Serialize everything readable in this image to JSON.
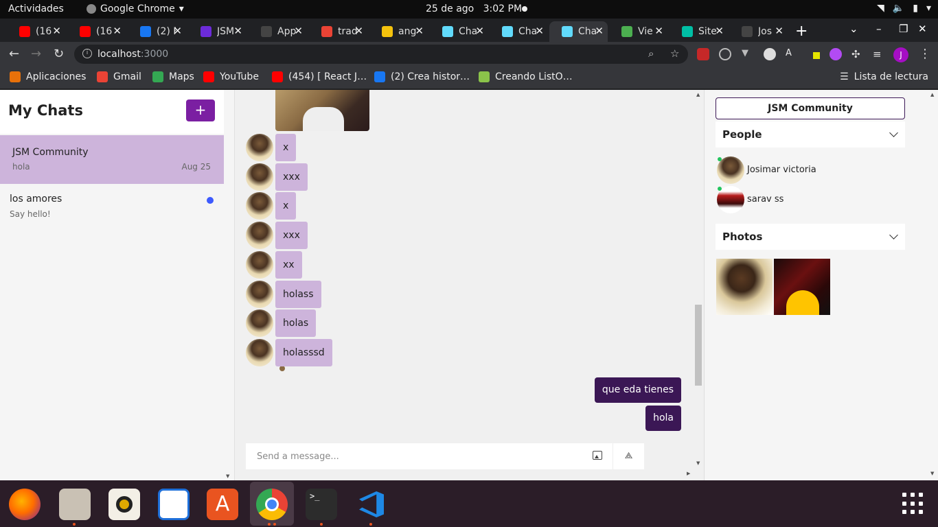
{
  "system_bar": {
    "activities": "Actividades",
    "app_name": "Google Chrome",
    "date": "25 de ago",
    "time": "3:02 PM"
  },
  "browser": {
    "tabs": [
      {
        "title": "(16",
        "icon": "youtube-icon",
        "color": "#ff0000"
      },
      {
        "title": "(16",
        "icon": "youtube-icon",
        "color": "#ff0000"
      },
      {
        "title": "(2) F",
        "icon": "facebook-icon",
        "color": "#1877f2"
      },
      {
        "title": "JSM",
        "icon": "jsm-icon",
        "color": "#6c2bd9"
      },
      {
        "title": "App",
        "icon": "github-icon",
        "color": "#444444"
      },
      {
        "title": "trad",
        "icon": "google-icon",
        "color": "#ea4335"
      },
      {
        "title": "ang",
        "icon": "docs-icon",
        "color": "#f4c20d"
      },
      {
        "title": "Cha",
        "icon": "react-icon",
        "color": "#61dafb"
      },
      {
        "title": "Cha",
        "icon": "react-icon",
        "color": "#61dafb"
      },
      {
        "title": "Cha",
        "icon": "react-icon",
        "color": "#61dafb"
      },
      {
        "title": "Vie",
        "icon": "chrome-icon",
        "color": "#4caf50"
      },
      {
        "title": "Site",
        "icon": "site-icon",
        "color": "#00bfa5"
      },
      {
        "title": "Jos",
        "icon": "github-icon",
        "color": "#444444"
      }
    ],
    "url_host": "localhost",
    "url_port": ":3000",
    "bookmarks": [
      {
        "label": "Aplicaciones",
        "icon": "apps-icon",
        "color": "#e8710a"
      },
      {
        "label": "Gmail",
        "icon": "gmail-icon",
        "color": "#ea4335"
      },
      {
        "label": "Maps",
        "icon": "maps-icon",
        "color": "#34a853"
      },
      {
        "label": "YouTube",
        "icon": "youtube-icon",
        "color": "#ff0000"
      },
      {
        "label": "(454) [ React J…",
        "icon": "youtube-icon",
        "color": "#ff0000"
      },
      {
        "label": "(2) Crea histor…",
        "icon": "facebook-icon",
        "color": "#1877f2"
      },
      {
        "label": "Creando ListO…",
        "icon": "bookmark-icon",
        "color": "#8bc34a"
      }
    ],
    "reading_list": "Lista de lectura",
    "profile_initial": "J"
  },
  "chats": {
    "title": "My Chats",
    "new_button": "+",
    "list": [
      {
        "title": "JSM Community",
        "subtitle": "hola",
        "date": "Aug 25"
      },
      {
        "title": "los amores",
        "subtitle": "Say hello!"
      }
    ]
  },
  "feed": {
    "incoming": [
      "x",
      "xxx",
      "x",
      "xxx",
      "xx",
      "holass",
      "holas",
      "holasssd"
    ],
    "outgoing": [
      "que eda tienes",
      "hola"
    ],
    "input_placeholder": "Send a message..."
  },
  "settings": {
    "chat_title": "JSM Community",
    "people_label": "People",
    "people": [
      {
        "name": "Josimar victoria"
      },
      {
        "name": "sarav ss"
      }
    ],
    "photos_label": "Photos"
  },
  "colors": {
    "accent": "#7b1fa2",
    "incoming_bubble": "#cdb4db",
    "outgoing_bubble": "#3b1755",
    "unread": "#3d5afe"
  }
}
